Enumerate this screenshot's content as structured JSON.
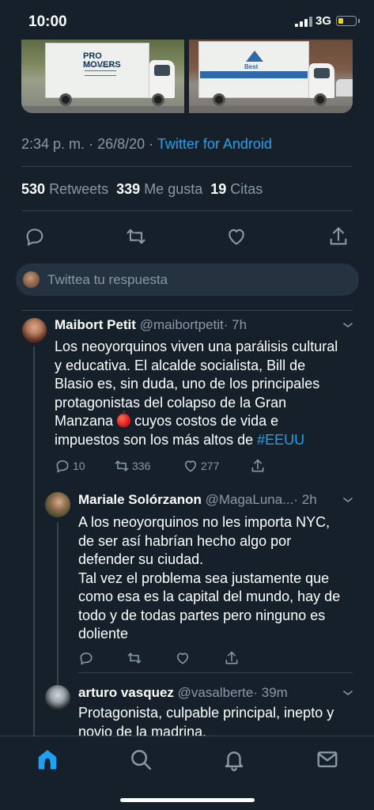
{
  "status_bar": {
    "time": "10:00",
    "network": "3G"
  },
  "media": {
    "left_truck_text": "PRO MOVERS",
    "right_truck_text": "Best"
  },
  "tweet_meta": {
    "time": "2:34 p. m.",
    "separator": "·",
    "date": "26/8/20",
    "source": "Twitter for Android"
  },
  "stats": {
    "retweets_count": "530",
    "retweets_label": "Retweets",
    "likes_count": "339",
    "likes_label": "Me gusta",
    "quotes_count": "19",
    "quotes_label": "Citas"
  },
  "actions": {
    "icons": [
      "reply-icon",
      "retweet-icon",
      "like-icon",
      "share-icon"
    ]
  },
  "reply_box": {
    "placeholder": "Twittea tu respuesta"
  },
  "replies": [
    {
      "name": "Maibort Petit",
      "handle": "@maibortpetit",
      "time": "· 7h",
      "lines": [
        "Los neoyorquinos viven una parálisis cultural",
        "y educativa. El alcalde socialista, Bill de",
        "Blasio es, sin duda,  uno de los principales",
        "protagonistas del colapso de la Gran",
        "Manzana",
        " cuyos  costos de vida e",
        "impuestos son los más altos de ",
        "#EEUU"
      ],
      "reply_count": "10",
      "retweet_count": "336",
      "like_count": "277"
    },
    {
      "name": "Mariale Solórzanon",
      "handle": "@MagaLuna...",
      "time": "· 2h",
      "lines": [
        "A los neoyorquinos no les importa NYC,",
        "de ser así habrían hecho algo por",
        "defender su ciudad.",
        "Tal vez el problema sea justamente que",
        "como esa es la capital del mundo, hay de",
        "todo y de todas partes pero ninguno es",
        "doliente"
      ]
    },
    {
      "name": "arturo vasquez",
      "handle": "@vasalberte",
      "time": "· 39m",
      "lines": [
        "Protagonista, culpable principal, inepto y",
        "novio de la madrina."
      ]
    }
  ],
  "colors": {
    "background": "#15202b",
    "accent": "#1da1f2",
    "secondary_text": "#8899a6",
    "divider": "#38444d"
  },
  "tab_bar": {
    "icons": [
      "home-icon",
      "search-icon",
      "notifications-icon",
      "messages-icon"
    ],
    "active": "home-icon"
  }
}
